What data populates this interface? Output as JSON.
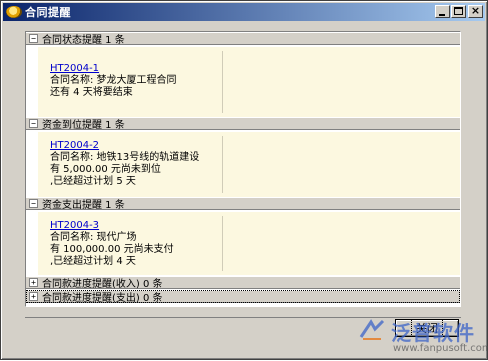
{
  "window": {
    "title": "合同提醒"
  },
  "sections": [
    {
      "toggle": "−",
      "label": "合同状态提醒 1 条",
      "link": "HT2004-1",
      "lines": [
        "合同名称: 梦龙大厦工程合同",
        "还有 4 天将要结束"
      ]
    },
    {
      "toggle": "−",
      "label": "资金到位提醒 1 条",
      "link": "HT2004-2",
      "lines": [
        "合同名称: 地铁13号线的轨道建设",
        "有 5,000.00 元尚未到位",
        ",已经超过计划 5 天"
      ]
    },
    {
      "toggle": "−",
      "label": "资金支出提醒 1 条",
      "link": "HT2004-3",
      "lines": [
        "合同名称: 现代广场",
        "有 100,000.00 元尚未支付",
        ",已经超过计划 4 天"
      ]
    },
    {
      "toggle": "+",
      "label": "合同款进度提醒(收入) 0 条"
    },
    {
      "toggle": "+",
      "label": "合同款进度提醒(支出) 0 条"
    }
  ],
  "footer": {
    "close_label": "关闭"
  },
  "watermark": {
    "brand": "泛普软件",
    "url": "www.fanpusoft.com"
  }
}
